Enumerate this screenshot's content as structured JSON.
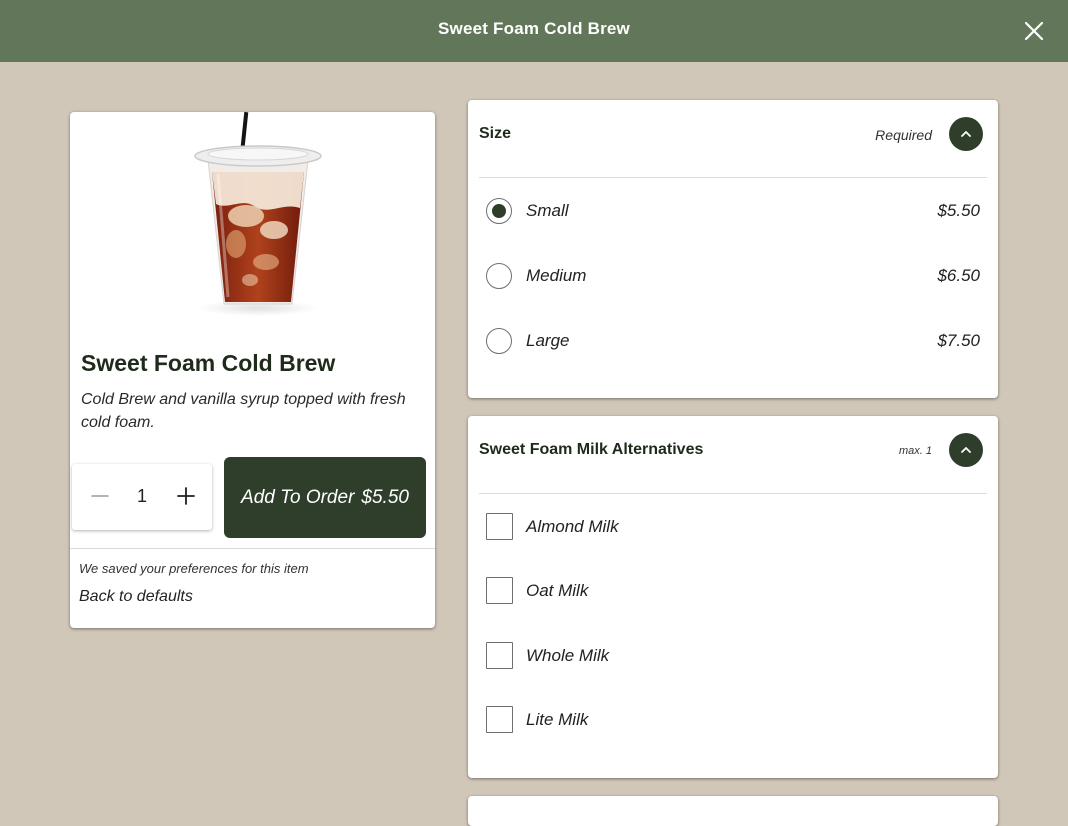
{
  "header": {
    "title": "Sweet Foam Cold Brew",
    "close_icon": "close-icon"
  },
  "product": {
    "name": "Sweet Foam Cold Brew",
    "description": "Cold Brew and vanilla syrup topped with fresh cold foam.",
    "quantity": "1",
    "add_button_label": "Add To Order",
    "add_button_price": "$5.50",
    "saved_note": "We saved your preferences for this item",
    "back_to_defaults": "Back to defaults"
  },
  "size_section": {
    "title": "Size",
    "note": "Required",
    "options": [
      {
        "label": "Small",
        "price": "$5.50",
        "selected": true
      },
      {
        "label": "Medium",
        "price": "$6.50",
        "selected": false
      },
      {
        "label": "Large",
        "price": "$7.50",
        "selected": false
      }
    ]
  },
  "milk_section": {
    "title": "Sweet Foam Milk Alternatives",
    "note": "max. 1",
    "options": [
      {
        "label": "Almond Milk",
        "checked": false
      },
      {
        "label": "Oat Milk",
        "checked": false
      },
      {
        "label": "Whole Milk",
        "checked": false
      },
      {
        "label": "Lite Milk",
        "checked": false
      }
    ]
  },
  "colors": {
    "header_bg": "#62775a",
    "page_bg": "#d1c7b9",
    "accent_dark_green": "#2e3e2a"
  }
}
